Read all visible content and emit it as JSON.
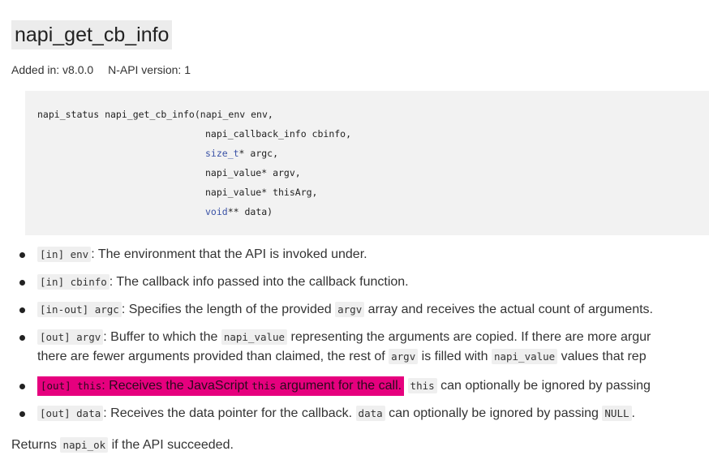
{
  "heading": "napi_get_cb_info",
  "meta": {
    "added": "Added in: v8.0.0",
    "napi_version": "N-API version: 1"
  },
  "code": {
    "lines": [
      {
        "plain": "napi_status napi_get_cb_info(napi_env env,",
        "kw": "",
        "rest": ""
      },
      {
        "plain": "",
        "kw": "",
        "rest": "napi_callback_info cbinfo,"
      },
      {
        "plain": "",
        "kw": "size_t",
        "rest": "* argc,"
      },
      {
        "plain": "",
        "kw": "",
        "rest": "napi_value* argv,"
      },
      {
        "plain": "",
        "kw": "",
        "rest": "napi_value* thisArg,"
      },
      {
        "plain": "",
        "kw": "void",
        "rest": "** data)"
      }
    ]
  },
  "params": {
    "env": {
      "code": "[in] env",
      "text": ": The environment that the API is invoked under."
    },
    "cbinfo": {
      "code": "[in] cbinfo",
      "text": ": The callback info passed into the callback function."
    },
    "argc": {
      "code": "[in-out] argc",
      "text1": ": Specifies the length of the provided ",
      "code2": "argv",
      "text2": " array and receives the actual count of arguments."
    },
    "argv": {
      "code": "[out] argv",
      "text1": ": Buffer to which the ",
      "code2": "napi_value",
      "text2": " representing the arguments are copied. If there are more argur",
      "line2_text1": "there are fewer arguments provided than claimed, the rest of ",
      "line2_code": "argv",
      "line2_text2": " is filled with ",
      "line2_code2": "napi_value",
      "line2_text3": " values that rep"
    },
    "this": {
      "code": "[out] this",
      "text1": ": Receives the JavaScript ",
      "code2": "this",
      "text2": " argument for the call.",
      "code3": "this",
      "text3": " can optionally be ignored by passing"
    },
    "data": {
      "code": "[out] data",
      "text1": ": Receives the data pointer for the callback. ",
      "code2": "data",
      "text2": " can optionally be ignored by passing ",
      "code3": "NULL",
      "text3": "."
    }
  },
  "returns": {
    "text1": "Returns ",
    "code": "napi_ok",
    "text2": " if the API succeeded."
  },
  "colors": {
    "highlight": "#e6007e",
    "code_bg": "#f2f2f2",
    "keyword": "#3a52a6"
  }
}
